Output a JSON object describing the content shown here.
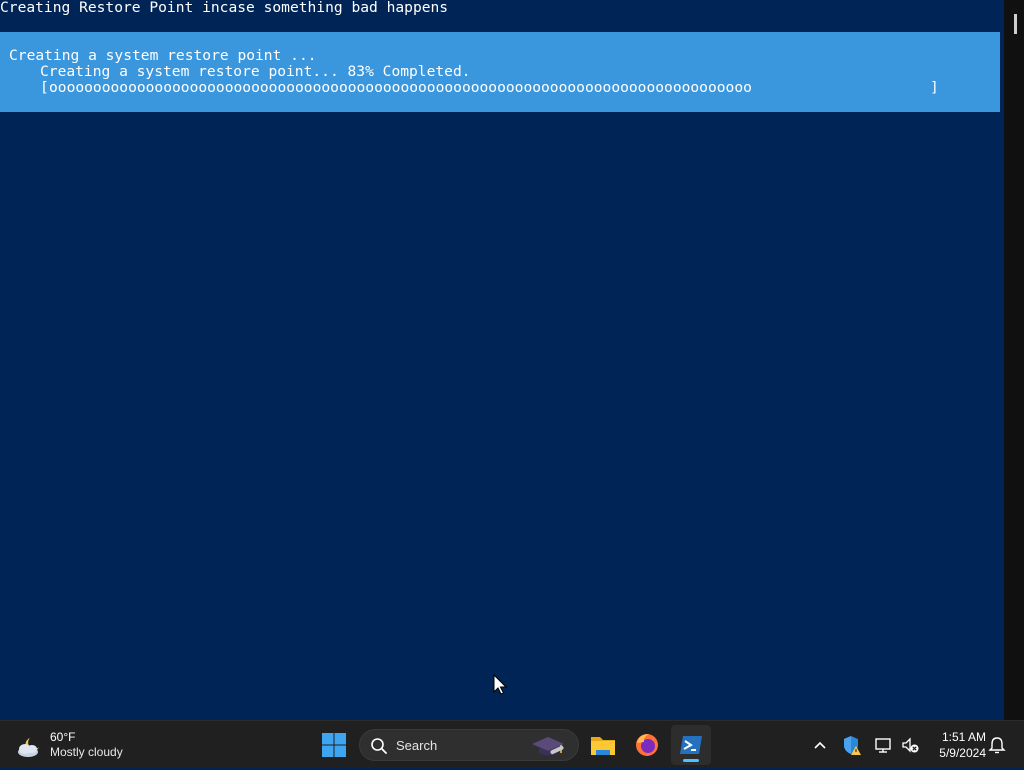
{
  "console": {
    "header_line": "Creating Restore Point incase something bad happens",
    "progress": {
      "activity": "Creating a system restore point ...",
      "status": "Creating a system restore point... 83% Completed.",
      "percent": 83,
      "bar_open": "[",
      "bar_fill": "oooooooooooooooooooooooooooooooooooooooooooooooooooooooooooooooooooooooooooooooo",
      "bar_close": "]"
    },
    "colors": {
      "background": "#012456",
      "progress_background": "#3a96dd",
      "text": "#ffffff"
    }
  },
  "taskbar": {
    "weather": {
      "temperature": "60°F",
      "description": "Mostly cloudy",
      "icon": "partly-cloudy-night-icon"
    },
    "start_icon": "windows-start-icon",
    "search": {
      "label": "Search"
    },
    "pinned_apps": [
      {
        "name": "file-explorer",
        "icon": "folder-icon"
      },
      {
        "name": "firefox",
        "icon": "firefox-icon"
      },
      {
        "name": "powershell",
        "icon": "powershell-icon",
        "active": true
      }
    ],
    "tray": {
      "icons": [
        "chevron-up-icon",
        "windows-security-warning-icon",
        "network-icon",
        "volume-muted-icon"
      ],
      "time": "1:51 AM",
      "date": "5/9/2024",
      "notification_icon": "notification-bell-icon"
    }
  }
}
